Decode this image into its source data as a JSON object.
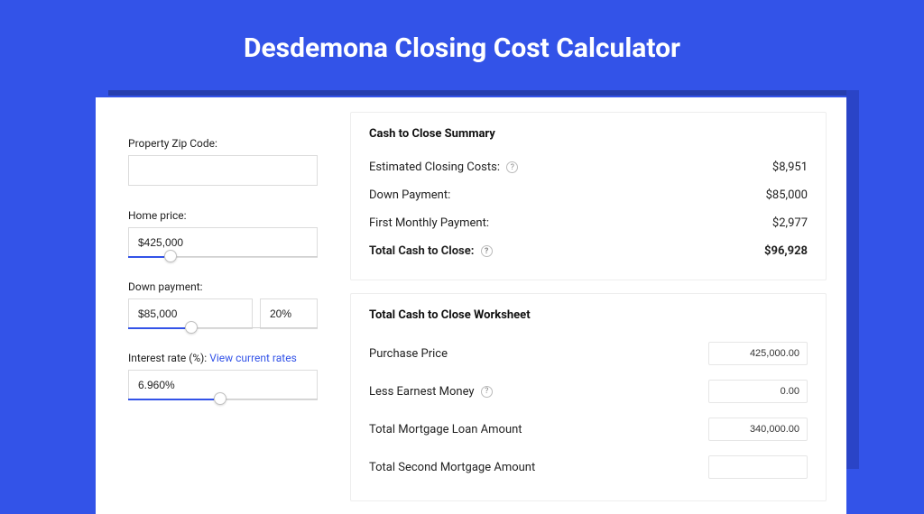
{
  "title": "Desdemona Closing Cost Calculator",
  "left": {
    "zip_label": "Property Zip Code:",
    "zip_value": "",
    "home_price_label": "Home price:",
    "home_price_value": "$425,000",
    "down_payment_label": "Down payment:",
    "down_payment_value": "$85,000",
    "down_payment_pct": "20%",
    "rate_label_prefix": "Interest rate (%): ",
    "rate_link": "View current rates",
    "rate_value": "6.960%"
  },
  "summary": {
    "title": "Cash to Close Summary",
    "rows": [
      {
        "label": "Estimated Closing Costs:",
        "help": true,
        "value": "$8,951",
        "bold": false
      },
      {
        "label": "Down Payment:",
        "help": false,
        "value": "$85,000",
        "bold": false
      },
      {
        "label": "First Monthly Payment:",
        "help": false,
        "value": "$2,977",
        "bold": false
      },
      {
        "label": "Total Cash to Close:",
        "help": true,
        "value": "$96,928",
        "bold": true
      }
    ]
  },
  "worksheet": {
    "title": "Total Cash to Close Worksheet",
    "rows": [
      {
        "label": "Purchase Price",
        "help": false,
        "value": "425,000.00"
      },
      {
        "label": "Less Earnest Money",
        "help": true,
        "value": "0.00"
      },
      {
        "label": "Total Mortgage Loan Amount",
        "help": false,
        "value": "340,000.00"
      },
      {
        "label": "Total Second Mortgage Amount",
        "help": false,
        "value": ""
      }
    ]
  }
}
